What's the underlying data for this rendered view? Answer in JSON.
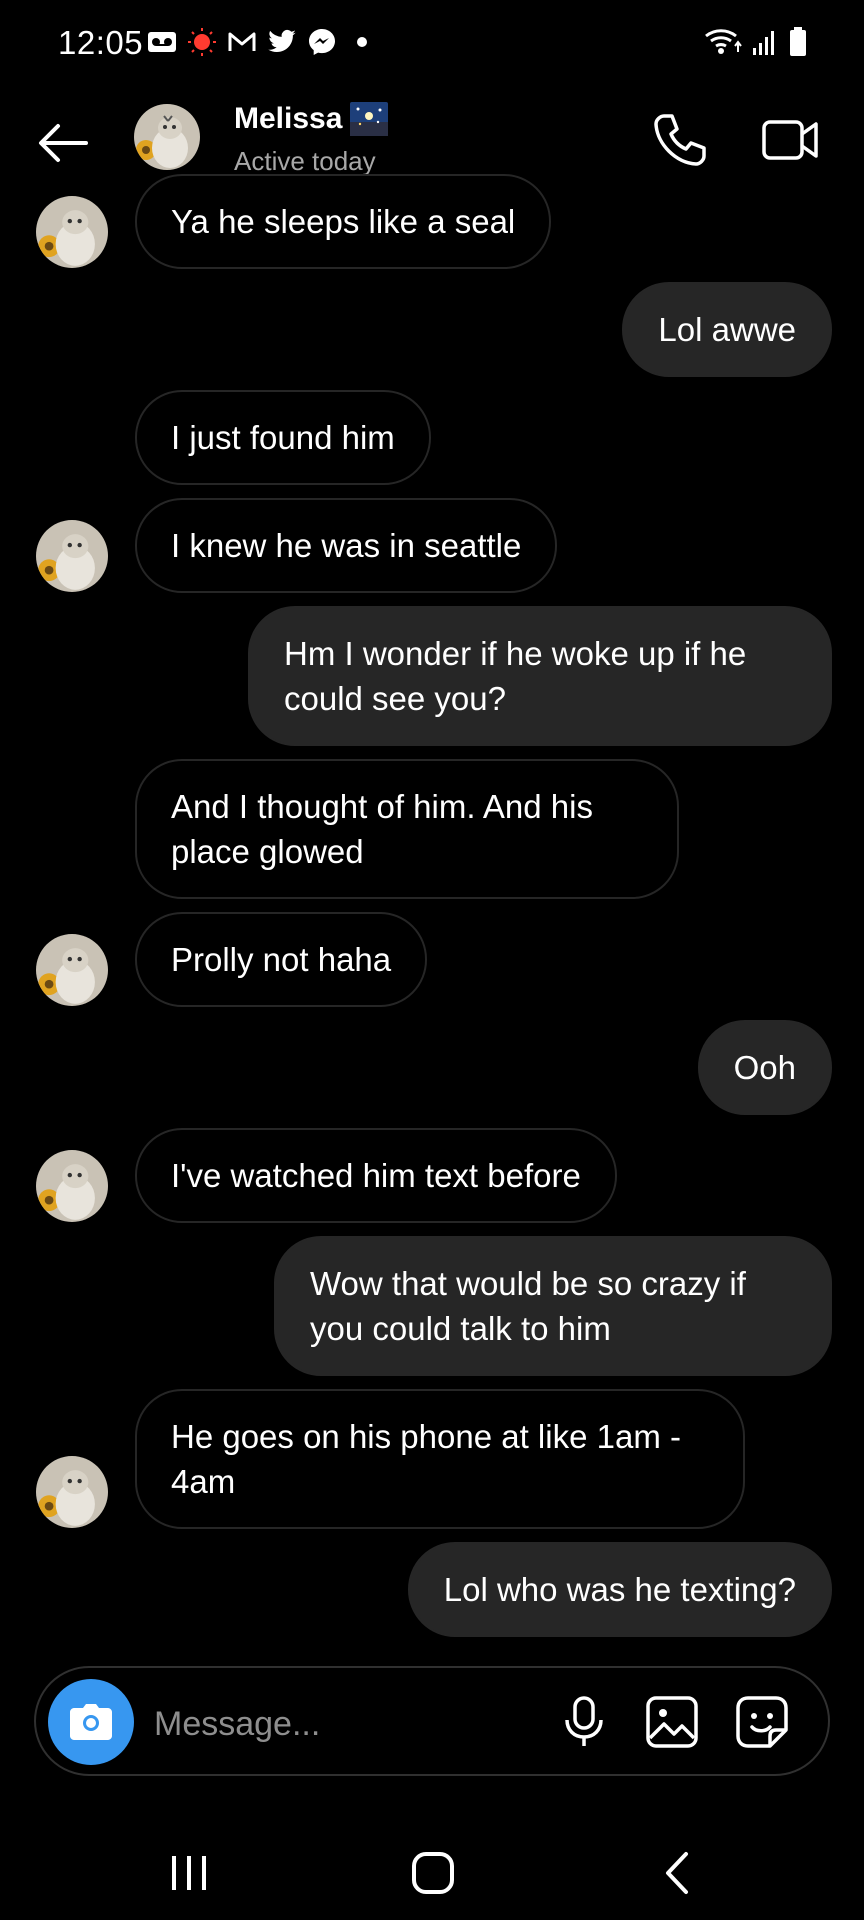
{
  "status_bar": {
    "time": "12:05",
    "notification_icons": [
      "voicemail-icon",
      "record-icon",
      "gmail-icon",
      "twitter-icon",
      "messenger-icon",
      "dot-icon"
    ],
    "system_icons": [
      "wifi-icon",
      "signal-icon",
      "battery-icon"
    ]
  },
  "header": {
    "name": "Melissa",
    "status": "Active today",
    "icons": [
      "back-arrow-icon",
      "phone-icon",
      "video-camera-icon"
    ]
  },
  "messages": [
    {
      "side": "in",
      "text": "Ya he sleeps like a seal"
    },
    {
      "side": "out",
      "text": "Lol awwe"
    },
    {
      "side": "in",
      "text": "I just found him"
    },
    {
      "side": "in",
      "text": "I knew he was in seattle"
    },
    {
      "side": "out",
      "text": "Hm I wonder if he woke up if he could see you?"
    },
    {
      "side": "in",
      "text": "And I thought of him. And his place glowed"
    },
    {
      "side": "in",
      "text": "Prolly not haha"
    },
    {
      "side": "out",
      "text": "Ooh"
    },
    {
      "side": "in",
      "text": "I've watched him text before"
    },
    {
      "side": "out",
      "text": "Wow that would be so crazy if you could talk to him"
    },
    {
      "side": "in",
      "text": "He goes on his phone at like 1am - 4am"
    },
    {
      "side": "out",
      "text": "Lol who was he texting?"
    }
  ],
  "composer": {
    "placeholder": "Message...",
    "camera_color": "#3797f0",
    "icons": [
      "camera-icon",
      "microphone-icon",
      "gallery-icon",
      "sticker-icon"
    ]
  },
  "nav": {
    "icons": [
      "recents-icon",
      "home-icon",
      "back-icon"
    ]
  }
}
